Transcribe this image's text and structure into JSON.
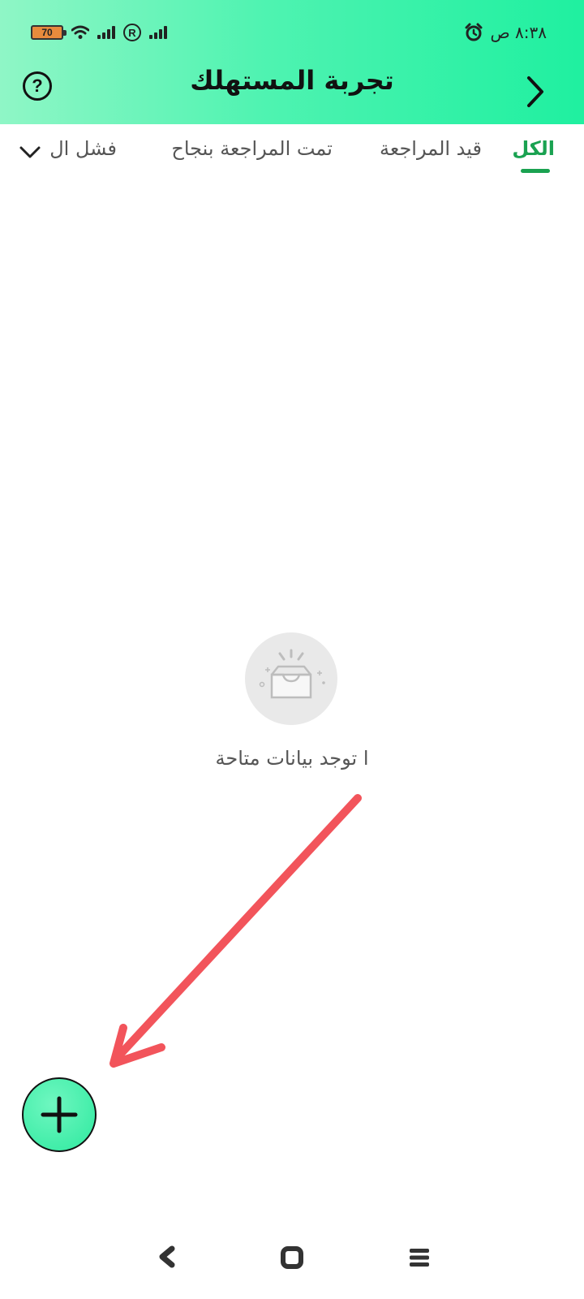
{
  "status_bar": {
    "battery_level": "70",
    "time": "٨:٣٨ ص",
    "icons": [
      "battery-icon",
      "wifi-icon",
      "signal-icon",
      "roaming-icon",
      "signal-icon",
      "alarm-icon"
    ]
  },
  "app_bar": {
    "title": "تجربة المستهلك",
    "back_icon": "chevron-right-icon",
    "help_icon": "help-icon",
    "help_glyph": "?"
  },
  "tabs": [
    {
      "label": "الكل",
      "active": true
    },
    {
      "label": "قيد المراجعة",
      "active": false
    },
    {
      "label": "تمت المراجعة بنجاح",
      "active": false
    },
    {
      "label": "فشل ال",
      "active": false
    }
  ],
  "empty_state": {
    "message": "ا توجد بيانات متاحة",
    "icon": "empty-box-icon"
  },
  "fab": {
    "icon": "plus-icon"
  },
  "colors": {
    "header_gradient_start": "#8ff6c6",
    "header_gradient_end": "#1ff0a0",
    "active_tab": "#1aa251",
    "annotation_arrow": "#f2545b",
    "fab_fill": "#2ee99f"
  }
}
